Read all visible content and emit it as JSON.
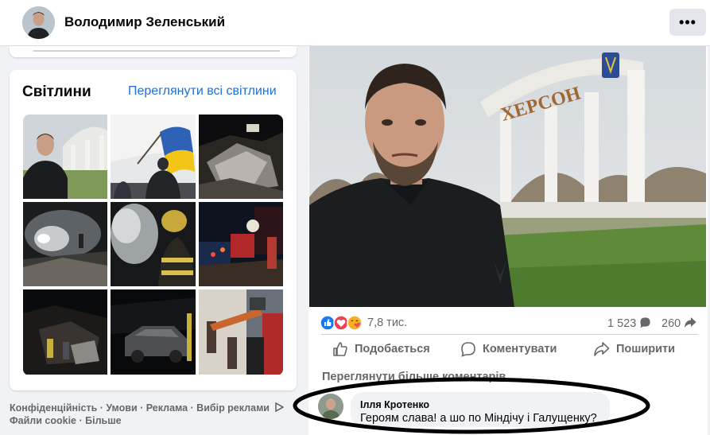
{
  "header": {
    "page_name": "Володимир Зеленський",
    "more_label": "•••"
  },
  "photos": {
    "title": "Світлини",
    "see_all": "Переглянути всі світлини",
    "items": [
      {
        "subject": "zelensky-selfie-kherson"
      },
      {
        "subject": "man-with-ukrainian-flag"
      },
      {
        "subject": "destroyed-building-night"
      },
      {
        "subject": "smoke-rubble-rescue"
      },
      {
        "subject": "firefighter-helmet"
      },
      {
        "subject": "fire-trucks-night"
      },
      {
        "subject": "firefighters-dark-ruins"
      },
      {
        "subject": "burned-car-night"
      },
      {
        "subject": "fire-ladder-building"
      }
    ]
  },
  "footer": {
    "line1": "Конфіденційність · Умови · Реклама · Вибір реклами",
    "line2": "Файли cookie · Більше"
  },
  "post": {
    "photo": {
      "sign_text": "ХЕРСОН",
      "subject": "zelensky-selfie-kherson-arch"
    },
    "reactions_count": "7,8 тис.",
    "comments_count": "1 523",
    "shares_count": "260",
    "actions": {
      "like": "Подобається",
      "comment": "Коментувати",
      "share": "Поширити"
    },
    "view_more_comments": "Переглянути більше коментарів",
    "comment": {
      "author": "Ілля Кротенко",
      "text": "Героям слава! а шо по Міндічу і Галущенку?"
    }
  },
  "colors": {
    "link": "#216fdb",
    "like_blue": "#1877f2",
    "love_red": "#f33e58",
    "care_yellow": "#f7b125",
    "secondary_text": "#65676b",
    "annotation": "#000000"
  }
}
